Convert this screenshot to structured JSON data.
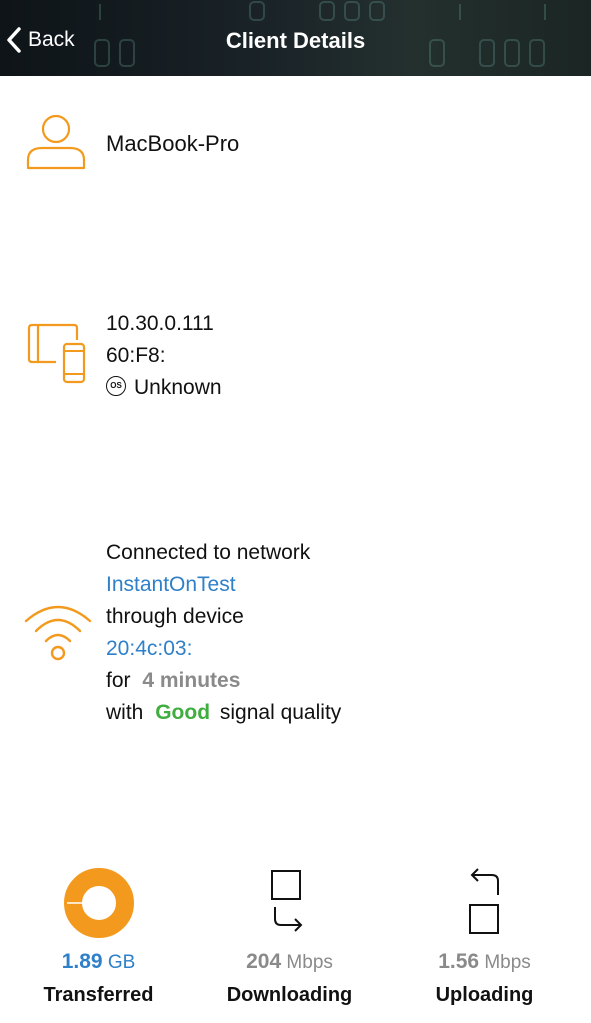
{
  "header": {
    "back_label": "Back",
    "title": "Client Details"
  },
  "client": {
    "name": "MacBook-Pro"
  },
  "device_info": {
    "ip": "10.30.0.111",
    "mac": "60:F8:",
    "os_badge": "OS",
    "os": "Unknown"
  },
  "connection": {
    "line1": "Connected to network",
    "network": "InstantOnTest",
    "line2": "through device",
    "device": "20:4c:03:",
    "for_label": "for",
    "duration": "4 minutes",
    "with_label": "with",
    "quality": "Good",
    "quality_suffix": "signal quality"
  },
  "stats": {
    "transferred": {
      "value": "1.89",
      "unit": "GB",
      "label": "Transferred"
    },
    "downloading": {
      "value": "204",
      "unit": "Mbps",
      "label": "Downloading"
    },
    "uploading": {
      "value": "1.56",
      "unit": "Mbps",
      "label": "Uploading"
    }
  },
  "colors": {
    "accent_orange": "#f39a1e",
    "link_blue": "#2f80c8",
    "good_green": "#3fae3f",
    "muted_gray": "#8a8a8a"
  },
  "icons": {
    "back": "chevron-left-icon",
    "client": "person-icon",
    "device": "devices-icon",
    "wifi": "wifi-icon",
    "transferred": "donut-icon",
    "downloading": "download-icon",
    "uploading": "upload-icon"
  }
}
